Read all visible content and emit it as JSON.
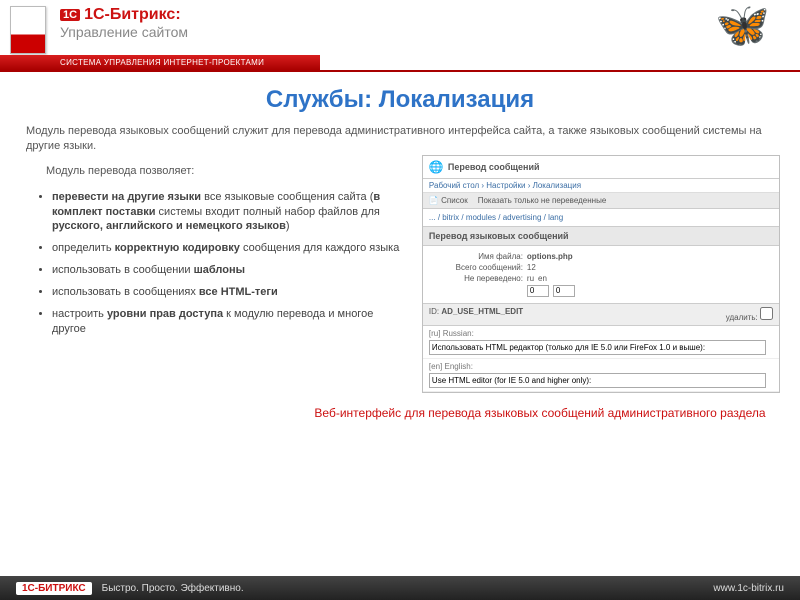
{
  "header": {
    "brand_prefix": "1С",
    "brand_name": "1С-Битрикс:",
    "brand_sub": "Управление сайтом",
    "redbar_text": "СИСТЕМА УПРАВЛЕНИЯ ИНТЕРНЕТ-ПРОЕКТАМИ"
  },
  "title": "Службы: Локализация",
  "intro": "Модуль перевода языковых сообщений служит для перевода административного интерфейса сайта, а также языковых сообщений системы на другие языки.",
  "subintro": "Модуль перевода позволяет:",
  "bullets": {
    "b1_a": "перевести на другие языки",
    "b1_b": " все языковые сообщения сайта (",
    "b1_c": "в комплект поставки",
    "b1_d": " системы входит полный набор файлов для ",
    "b1_e": "русского, английского и немецкого языков",
    "b1_f": ")",
    "b2_a": "определить ",
    "b2_b": "корректную кодировку",
    "b2_c": " сообщения для каждого языка",
    "b3_a": "использовать в сообщении ",
    "b3_b": "шаблоны",
    "b4_a": "использовать в сообщениях ",
    "b4_b": "все HTML-теги",
    "b5_a": "настроить ",
    "b5_b": "уровни прав доступа",
    "b5_c": " к модулю перевода и многое другое"
  },
  "shot": {
    "win_title": "Перевод сообщений",
    "breadcrumb": "Рабочий стол › Настройки › Локализация",
    "tool1": "Список",
    "tool2": "Показать только не переведенные",
    "path": "... / bitrix / modules / advertising / lang",
    "section": "Перевод языковых сообщений",
    "label_file": "Имя файла:",
    "file_value": "options.php",
    "label_total": "Всего сообщений:",
    "total_value": "12",
    "label_untr": "Не переведено:",
    "lang_a": "ru",
    "lang_b": "en",
    "val_a": "0",
    "val_b": "0",
    "col_id": "ID:",
    "id_value": "AD_USE_HTML_EDIT",
    "col_del": "удалить:",
    "lng_ru": "[ru] Russian:",
    "txt_ru": "Использовать HTML редактор (только для IE 5.0 или FireFox 1.0 и выше):",
    "lng_en": "[en] English:",
    "txt_en": "Use HTML editor (for IE 5.0 and higher only):"
  },
  "caption": "Веб-интерфейс для перевода языковых сообщений административного раздела",
  "footer": {
    "brand": "1С-БИТРИКС",
    "slogan": "Быстро. Просто. Эффективно.",
    "site": "www.1c-bitrix.ru"
  }
}
